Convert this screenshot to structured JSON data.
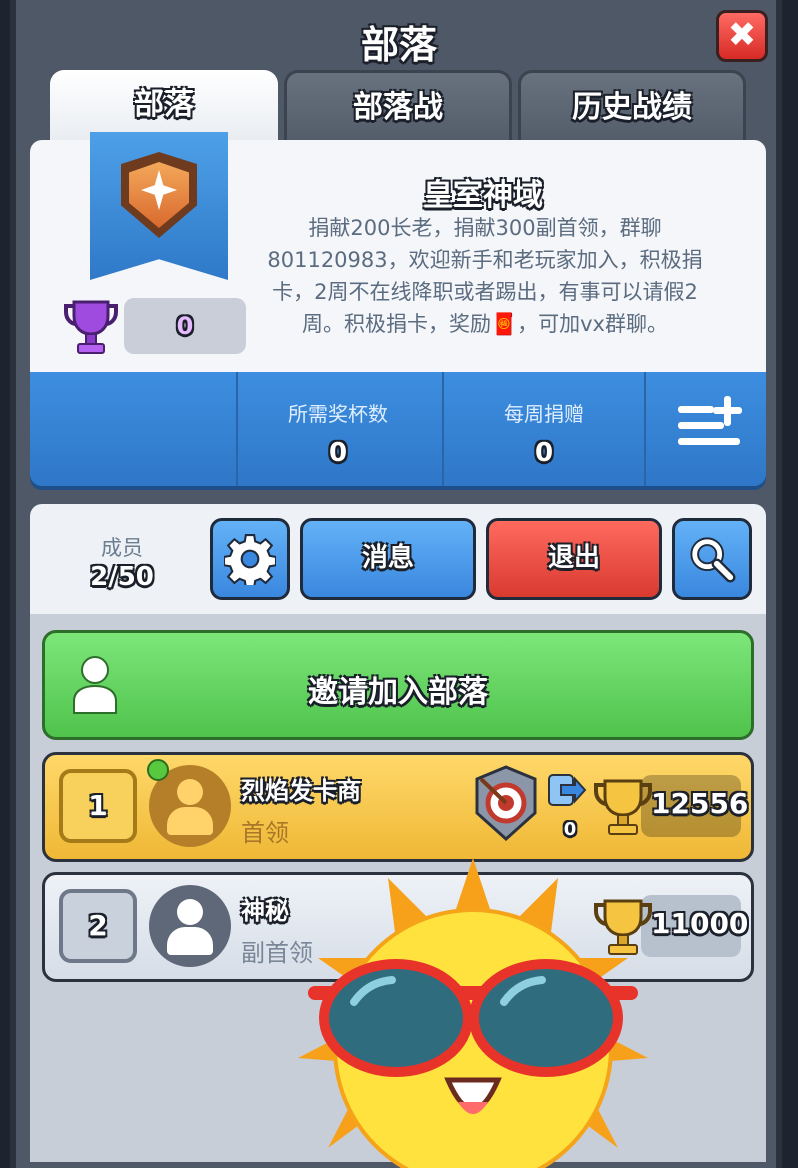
{
  "window": {
    "title": "部落",
    "close_label": "✖"
  },
  "tabs": [
    {
      "label": "部落",
      "active": true
    },
    {
      "label": "部落战",
      "active": false
    },
    {
      "label": "历史战绩",
      "active": false
    }
  ],
  "clan": {
    "name": "皇室神域",
    "description": "捐献200长老，捐献300副首领，群聊801120983，欢迎新手和老玩家加入，积极捐卡，2周不在线降职或者踢出，有事可以请假2周。积极捐卡，奖励🧧，可加vx群聊。",
    "trophies": "0",
    "required_trophies_label": "所需奖杯数",
    "required_trophies": "0",
    "weekly_donations_label": "每周捐赠",
    "weekly_donations": "0"
  },
  "members_bar": {
    "label": "成员",
    "count": "2/50",
    "message_label": "消息",
    "leave_label": "退出"
  },
  "invite": {
    "label": "邀请加入部落"
  },
  "members": [
    {
      "rank": "1",
      "name": "烈焰发卡商",
      "role": "首领",
      "donations": "0",
      "trophies": "12556",
      "online": true
    },
    {
      "rank": "2",
      "name": "神秘",
      "role": "副首领",
      "trophies": "11000",
      "online": false
    }
  ],
  "colors": {
    "accent_blue": "#3a87df",
    "leave_red": "#d93a30",
    "invite_green": "#4fc34c",
    "leader_gold": "#efb835"
  }
}
